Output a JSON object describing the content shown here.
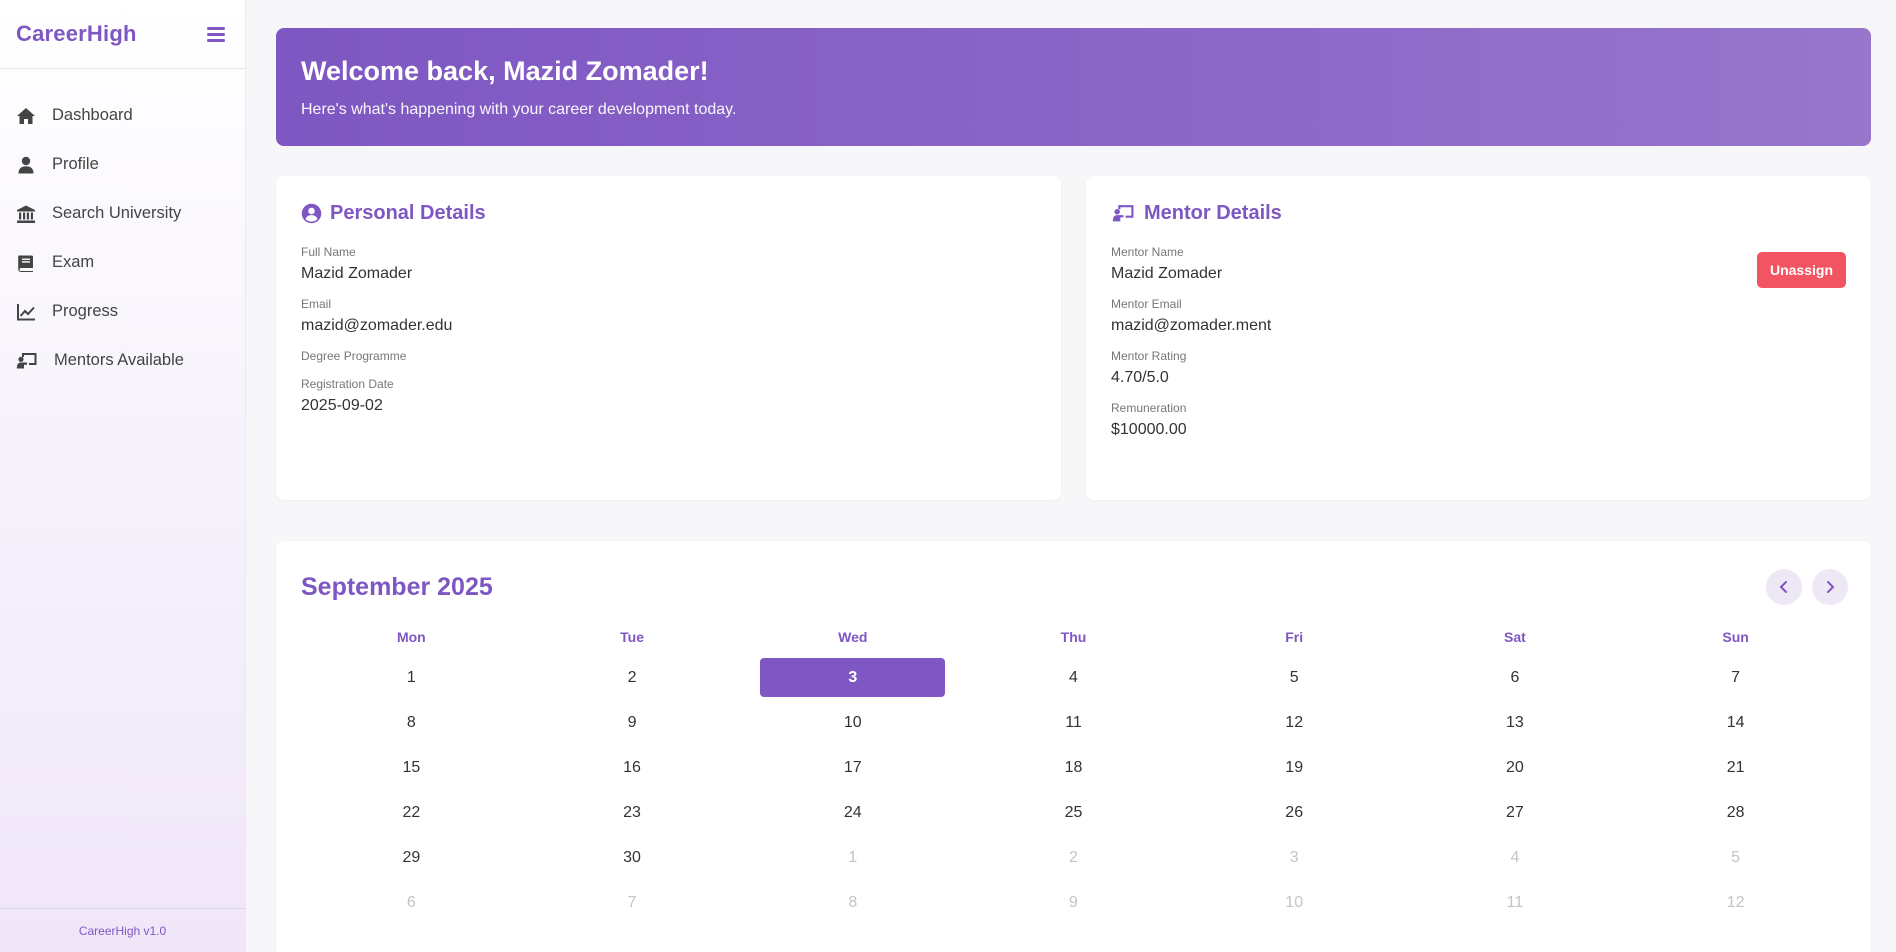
{
  "sidebar": {
    "brand": "CareerHigh",
    "items": [
      {
        "label": "Dashboard",
        "icon": "home-icon"
      },
      {
        "label": "Profile",
        "icon": "user-icon"
      },
      {
        "label": "Search University",
        "icon": "university-icon"
      },
      {
        "label": "Exam",
        "icon": "book-icon"
      },
      {
        "label": "Progress",
        "icon": "chart-line-icon"
      },
      {
        "label": "Mentors Available",
        "icon": "chalkboard-teacher-icon"
      }
    ],
    "footer": "CareerHigh v1.0"
  },
  "banner": {
    "title": "Welcome back, Mazid Zomader!",
    "subtitle": "Here's what's happening with your career development today."
  },
  "personal": {
    "title": "Personal Details",
    "full_name_label": "Full Name",
    "full_name": "Mazid Zomader",
    "email_label": "Email",
    "email": "mazid@zomader.edu",
    "degree_label": "Degree Programme",
    "degree": "",
    "reg_label": "Registration Date",
    "reg_date": "2025-09-02"
  },
  "mentor": {
    "title": "Mentor Details",
    "name_label": "Mentor Name",
    "name": "Mazid Zomader",
    "email_label": "Mentor Email",
    "email": "mazid@zomader.ment",
    "rating_label": "Mentor Rating",
    "rating": "4.70/5.0",
    "remuneration_label": "Remuneration",
    "remuneration": "$10000.00",
    "unassign_label": "Unassign"
  },
  "calendar": {
    "title": "September 2025",
    "weekdays": [
      "Mon",
      "Tue",
      "Wed",
      "Thu",
      "Fri",
      "Sat",
      "Sun"
    ],
    "days": [
      {
        "d": "1",
        "o": false
      },
      {
        "d": "2",
        "o": false
      },
      {
        "d": "3",
        "o": false,
        "t": true
      },
      {
        "d": "4",
        "o": false
      },
      {
        "d": "5",
        "o": false
      },
      {
        "d": "6",
        "o": false
      },
      {
        "d": "7",
        "o": false
      },
      {
        "d": "8",
        "o": false
      },
      {
        "d": "9",
        "o": false
      },
      {
        "d": "10",
        "o": false
      },
      {
        "d": "11",
        "o": false
      },
      {
        "d": "12",
        "o": false
      },
      {
        "d": "13",
        "o": false
      },
      {
        "d": "14",
        "o": false
      },
      {
        "d": "15",
        "o": false
      },
      {
        "d": "16",
        "o": false
      },
      {
        "d": "17",
        "o": false
      },
      {
        "d": "18",
        "o": false
      },
      {
        "d": "19",
        "o": false
      },
      {
        "d": "20",
        "o": false
      },
      {
        "d": "21",
        "o": false
      },
      {
        "d": "22",
        "o": false
      },
      {
        "d": "23",
        "o": false
      },
      {
        "d": "24",
        "o": false
      },
      {
        "d": "25",
        "o": false
      },
      {
        "d": "26",
        "o": false
      },
      {
        "d": "27",
        "o": false
      },
      {
        "d": "28",
        "o": false
      },
      {
        "d": "29",
        "o": false
      },
      {
        "d": "30",
        "o": false
      },
      {
        "d": "1",
        "o": true
      },
      {
        "d": "2",
        "o": true
      },
      {
        "d": "3",
        "o": true
      },
      {
        "d": "4",
        "o": true
      },
      {
        "d": "5",
        "o": true
      },
      {
        "d": "6",
        "o": true
      },
      {
        "d": "7",
        "o": true
      },
      {
        "d": "8",
        "o": true
      },
      {
        "d": "9",
        "o": true
      },
      {
        "d": "10",
        "o": true
      },
      {
        "d": "11",
        "o": true
      },
      {
        "d": "12",
        "o": true
      }
    ]
  },
  "colors": {
    "accent": "#7e57c2",
    "danger": "#f25561",
    "muted_day": "#c4c4c4"
  }
}
